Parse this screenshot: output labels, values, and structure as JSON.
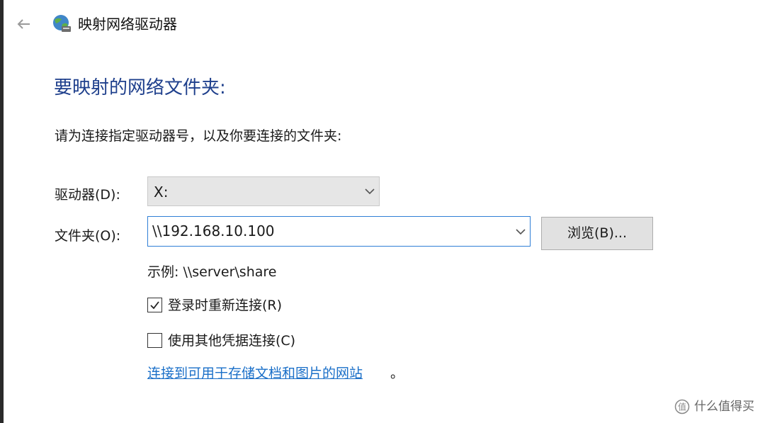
{
  "window": {
    "title": "映射网络驱动器"
  },
  "page": {
    "heading": "要映射的网络文件夹:",
    "instruction": "请为连接指定驱动器号，以及你要连接的文件夹:"
  },
  "drive": {
    "label": "驱动器(D):",
    "value": "X:"
  },
  "folder": {
    "label": "文件夹(O):",
    "value": "\\\\192.168.10.100",
    "browse_label": "浏览(B)..."
  },
  "example": "示例: \\\\server\\share",
  "options": {
    "reconnect": {
      "label": "登录时重新连接(R)",
      "checked": true
    },
    "other_credentials": {
      "label": "使用其他凭据连接(C)",
      "checked": false
    }
  },
  "link": {
    "text": "连接到可用于存储文档和图片的网站",
    "trailing": "。"
  },
  "watermark": {
    "text": "什么值得买"
  },
  "icons": {
    "back": "back-arrow-icon",
    "title": "network-drive-icon",
    "drive_dropdown": "chevron-down-icon",
    "folder_dropdown": "chevron-down-icon",
    "checkmark": "checkmark-icon",
    "watermark_logo": "smzdm-logo-icon"
  },
  "colors": {
    "heading": "#1e3f8c",
    "link": "#1a6fc8",
    "focus_border": "#2f7fd6"
  }
}
